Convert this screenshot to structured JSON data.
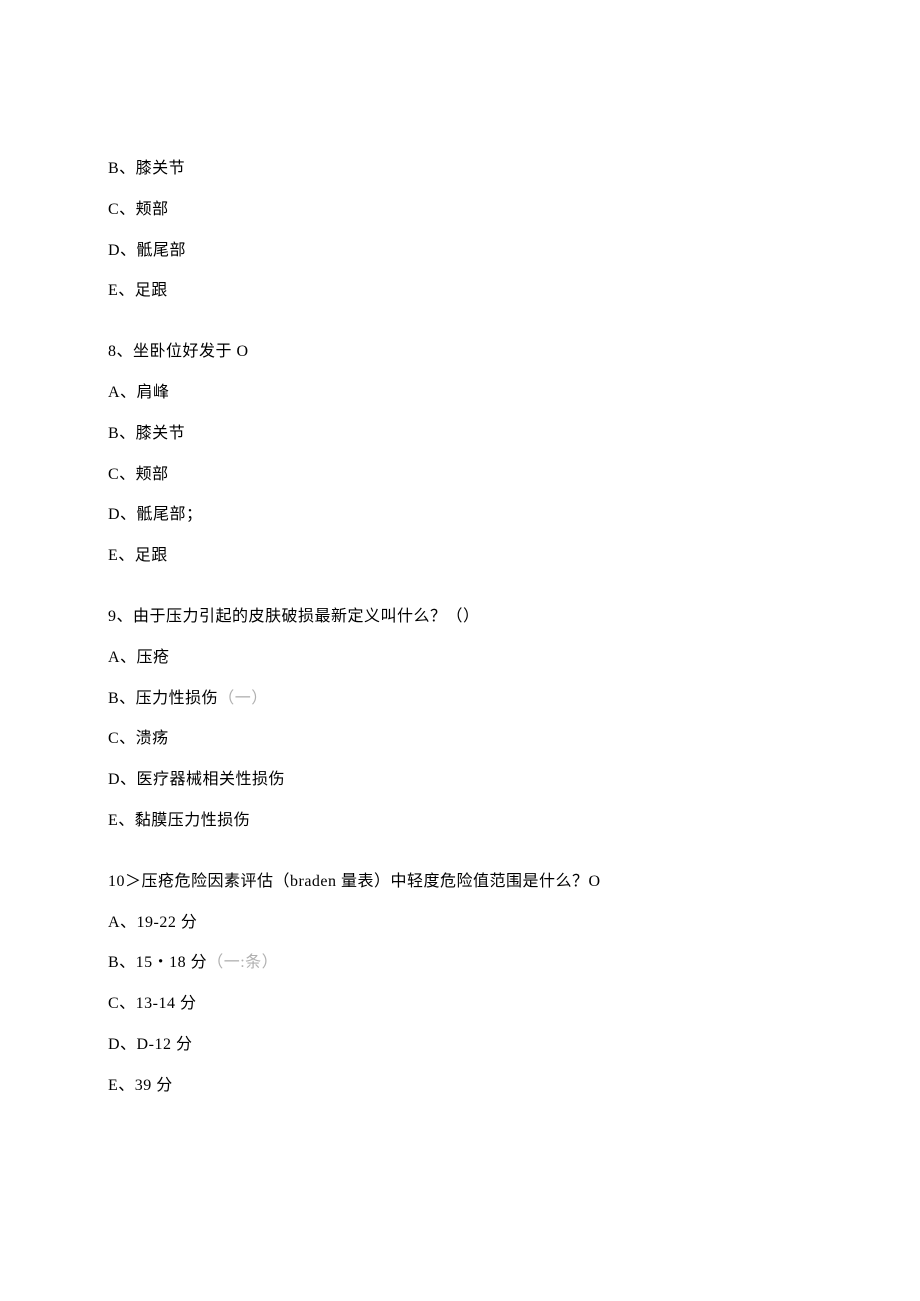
{
  "group1": {
    "optB": "B、膝关节",
    "optC": "C、颊部",
    "optD": "D、骶尾部",
    "optE": "E、足跟"
  },
  "q8": {
    "stem": "8、坐卧位好发于 O",
    "optA": "A、肩峰",
    "optB": "B、膝关节",
    "optC": "C、颊部",
    "optD": "D、骶尾部；",
    "optE": "E、足跟"
  },
  "q9": {
    "stem": "9、由于压力引起的皮肤破损最新定义叫什么？（）",
    "optA": "A、压疮",
    "optB_prefix": "B、压力性损伤",
    "optB_mark": "（一）",
    "optC": "C、溃疡",
    "optD": "D、医疗器械相关性损伤",
    "optE": "E、黏膜压力性损伤"
  },
  "q10": {
    "stem": "10＞压疮危险因素评估（braden 量表）中轻度危险值范围是什么？O",
    "optA": "A、19-22 分",
    "optB_prefix": "B、15・18 分",
    "optB_mark": "（一:条）",
    "optC": "C、13-14 分",
    "optD": "D、D-12 分",
    "optE": "E、39 分"
  }
}
